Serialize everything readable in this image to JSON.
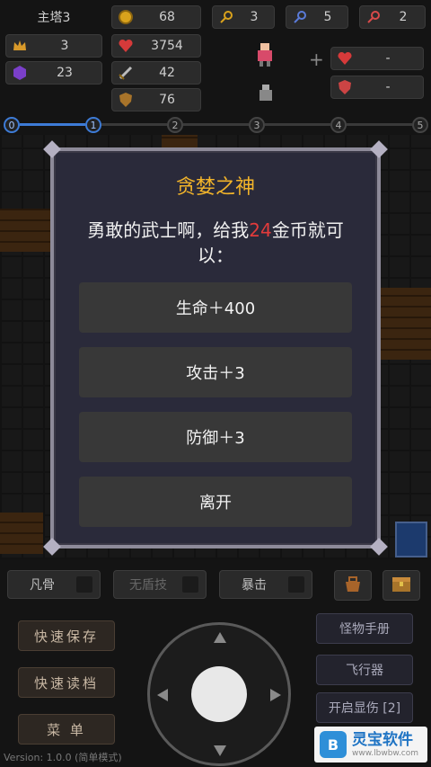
{
  "hud": {
    "floor": "主塔3",
    "gold": "68",
    "key_yellow": "3",
    "key_blue": "5",
    "key_red": "2",
    "crown": "3",
    "hp": "3754",
    "gem": "23",
    "atk": "42",
    "def": "76",
    "equip_slot1": "-",
    "equip_slot2": "-",
    "plus": "+"
  },
  "progress": {
    "nodes": [
      "0",
      "1",
      "2",
      "3",
      "4",
      "5"
    ],
    "active_index": 1
  },
  "dialog": {
    "title": "贪婪之神",
    "message_pre": "勇敢的武士啊，给我",
    "cost": "24",
    "message_post": "金币就可以：",
    "options": [
      "生命＋400",
      "攻击＋3",
      "防御＋3",
      "离开"
    ]
  },
  "skills": {
    "s1": "凡骨",
    "s2": "无盾技",
    "s3": "暴击"
  },
  "left_buttons": [
    "快速保存",
    "快速读档",
    "菜 单"
  ],
  "right_buttons": [
    "怪物手册",
    "飞行器",
    "开启显伤 [2]"
  ],
  "version": "Version: 1.0.0 (简单模式)",
  "watermark": {
    "name": "灵宝软件",
    "url": "www.lbwbw.com"
  },
  "colors": {
    "title": "#f2b42a",
    "cost": "#e23b3b",
    "progress_active": "#3d7bd6"
  }
}
